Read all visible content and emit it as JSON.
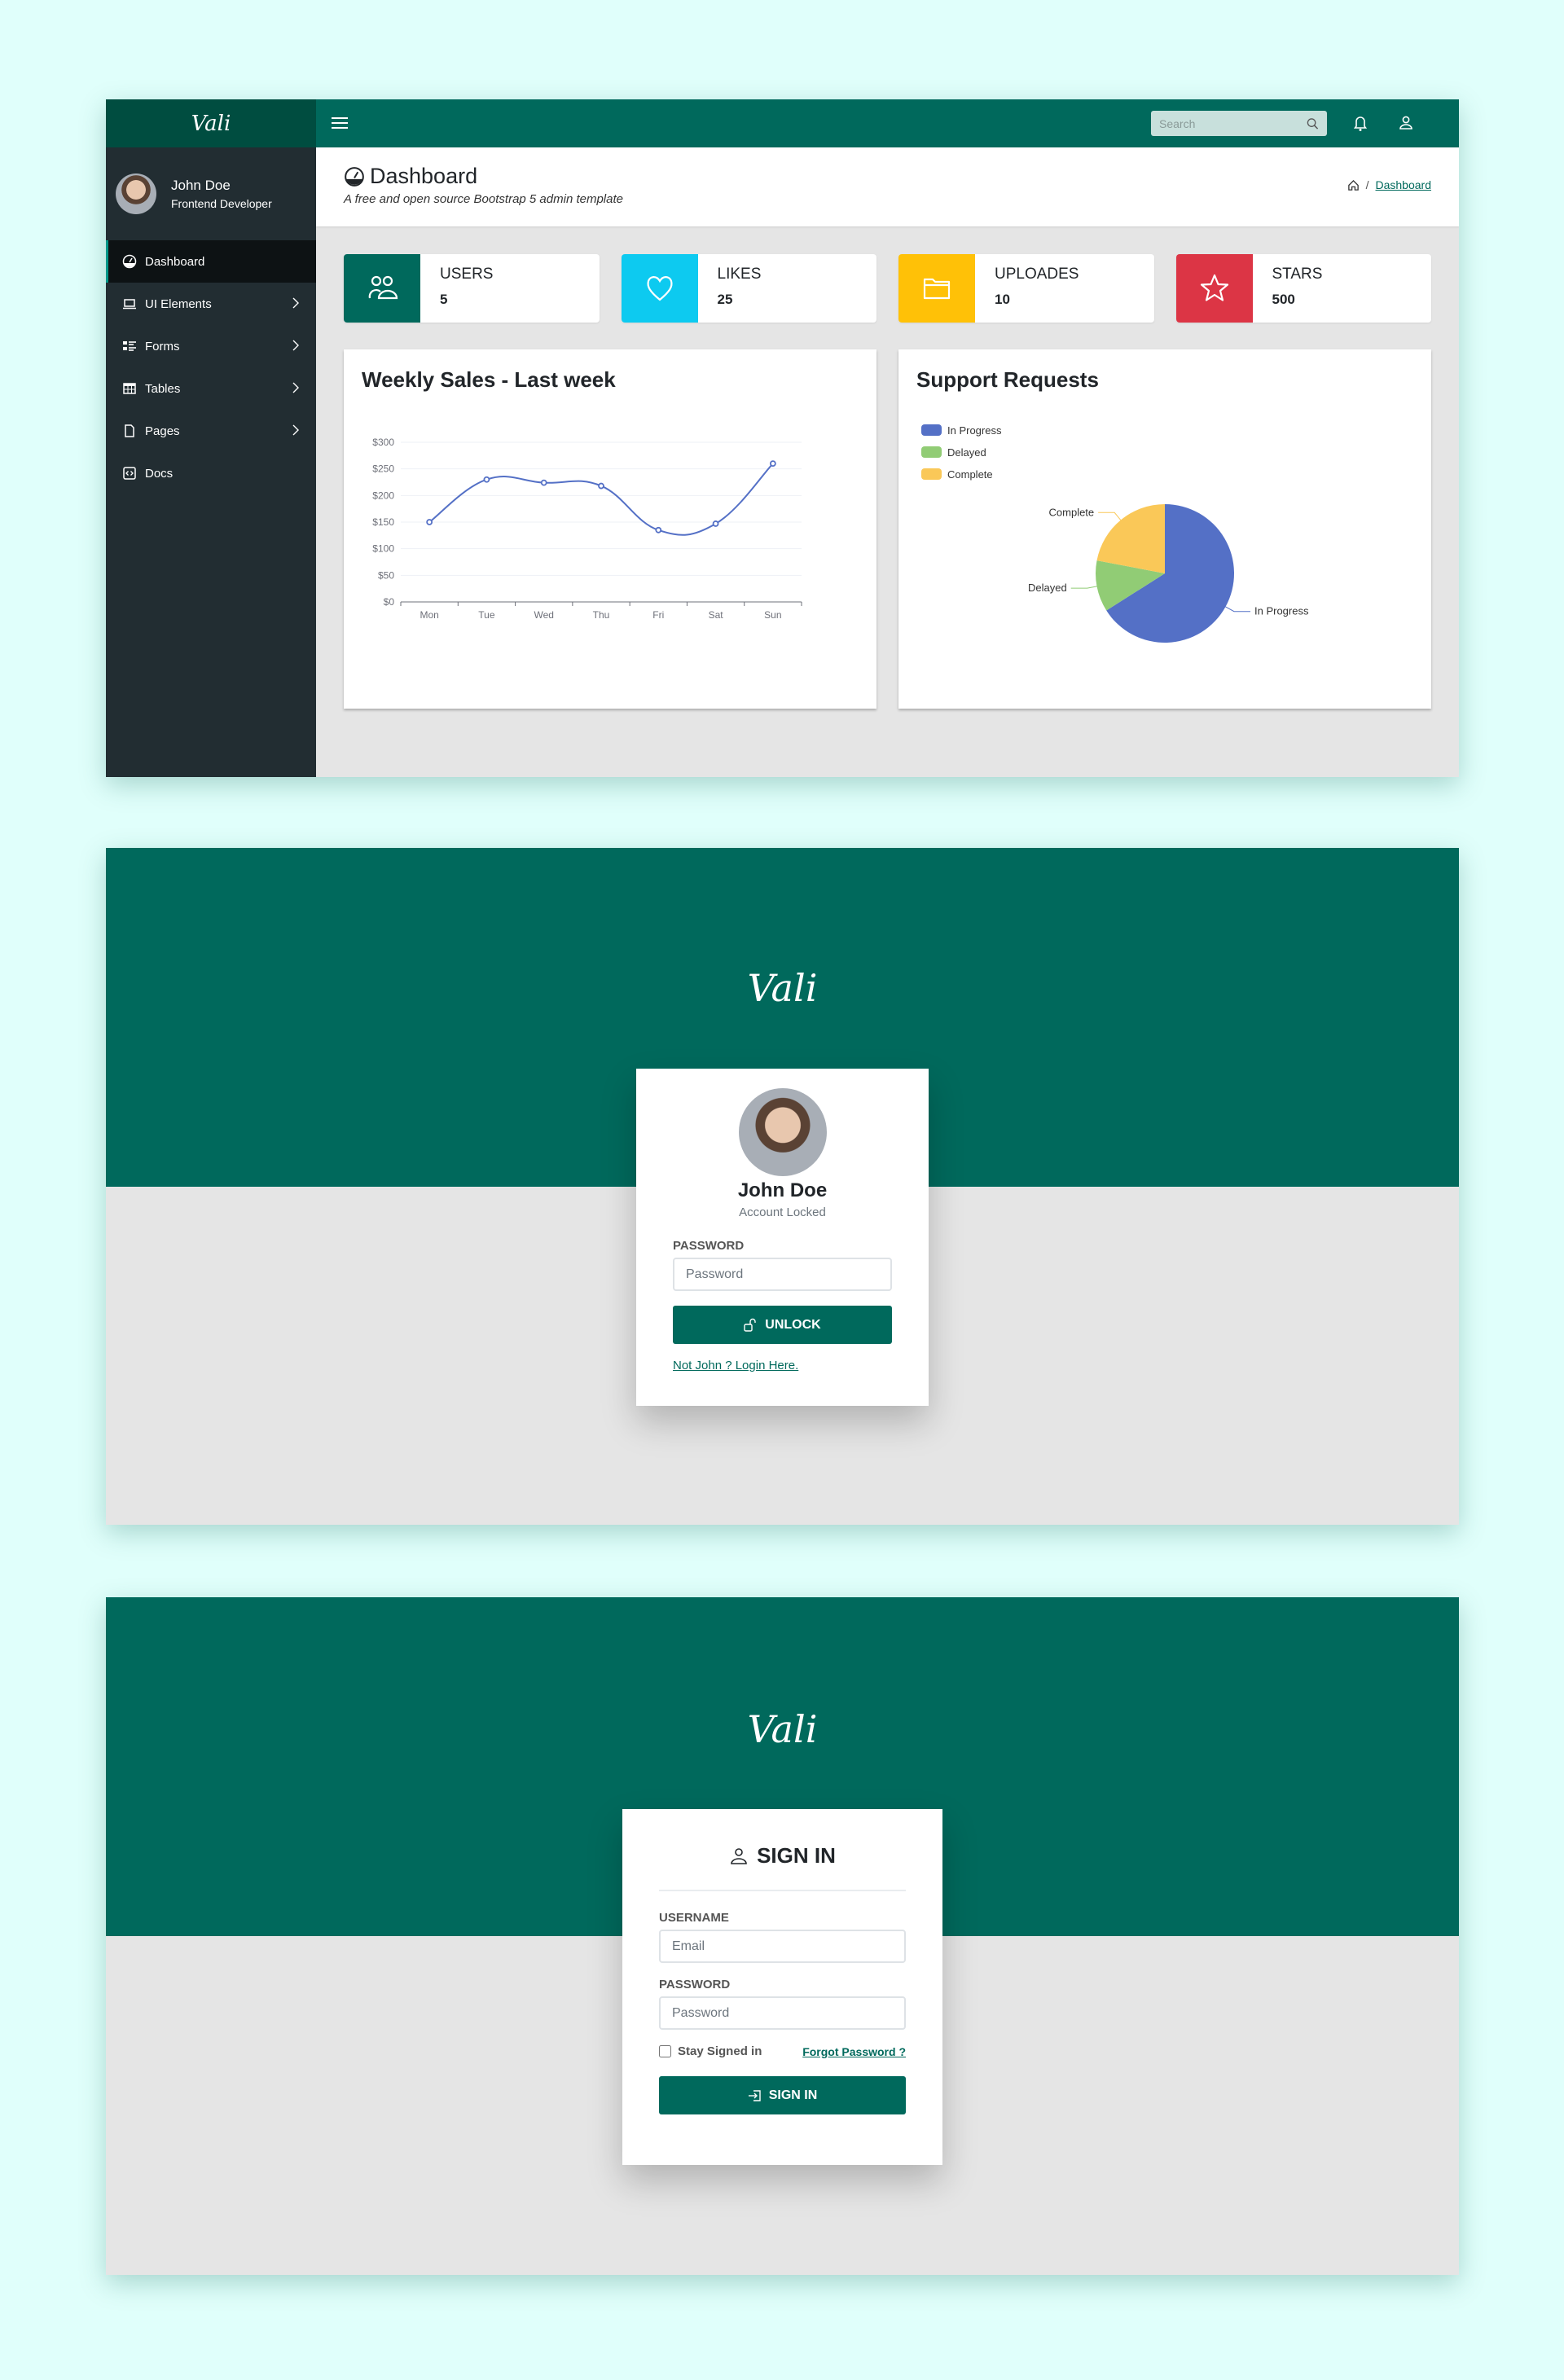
{
  "dashboard": {
    "brand": "Vali",
    "search": {
      "placeholder": "Search"
    },
    "user": {
      "name": "John Doe",
      "role": "Frontend Developer"
    },
    "sidebar": {
      "items": [
        {
          "label": "Dashboard",
          "icon": "speedometer-icon",
          "active": true,
          "has_children": false
        },
        {
          "label": "UI Elements",
          "icon": "laptop-icon",
          "active": false,
          "has_children": true
        },
        {
          "label": "Forms",
          "icon": "ui-checks-icon",
          "active": false,
          "has_children": true
        },
        {
          "label": "Tables",
          "icon": "table-icon",
          "active": false,
          "has_children": true
        },
        {
          "label": "Pages",
          "icon": "file-icon",
          "active": false,
          "has_children": true
        },
        {
          "label": "Docs",
          "icon": "code-square-icon",
          "active": false,
          "has_children": false
        }
      ]
    },
    "header": {
      "title": "Dashboard",
      "subtitle": "A free and open source Bootstrap 5 admin template",
      "breadcrumb": [
        "home-icon",
        "Dashboard"
      ]
    },
    "widgets": [
      {
        "label": "USERS",
        "value": "5",
        "icon": "people-icon",
        "color": "#00695c"
      },
      {
        "label": "LIKES",
        "value": "25",
        "icon": "heart-icon",
        "color": "#0dcaf0"
      },
      {
        "label": "UPLOADES",
        "value": "10",
        "icon": "folder-icon",
        "color": "#ffc107"
      },
      {
        "label": "STARS",
        "value": "500",
        "icon": "star-icon",
        "color": "#dc3545"
      }
    ],
    "colors": {
      "primary": "#00695c",
      "primary_dark": "#004d40",
      "sidebar": "#222d32"
    }
  },
  "chart_data": [
    {
      "type": "line",
      "title": "Weekly Sales - Last week",
      "categories": [
        "Mon",
        "Tue",
        "Wed",
        "Thu",
        "Fri",
        "Sat",
        "Sun"
      ],
      "values": [
        150,
        230,
        224,
        218,
        135,
        147,
        260
      ],
      "ylim": [
        0,
        300
      ],
      "yticks": [
        "$0",
        "$50",
        "$100",
        "$150",
        "$200",
        "$250",
        "$300"
      ],
      "ytick_values": [
        0,
        50,
        100,
        150,
        200,
        250,
        300
      ],
      "xlabel": "",
      "ylabel": "",
      "grid": true,
      "smooth": true,
      "color": "#5470c6"
    },
    {
      "type": "pie",
      "title": "Support Requests",
      "legend_position": "top-left",
      "slices": [
        {
          "name": "In Progress",
          "value": 66,
          "color": "#5470c6"
        },
        {
          "name": "Delayed",
          "value": 12,
          "color": "#91cc75"
        },
        {
          "name": "Complete",
          "value": 22,
          "color": "#fac858"
        }
      ]
    }
  ],
  "lockscreen": {
    "brand": "Vali",
    "user_name": "John Doe",
    "status": "Account Locked",
    "password_label": "PASSWORD",
    "password_placeholder": "Password",
    "unlock_label": "UNLOCK",
    "switch_user_link": "Not John ? Login Here."
  },
  "login": {
    "brand": "Vali",
    "title": "SIGN IN",
    "username_label": "USERNAME",
    "username_placeholder": "Email",
    "password_label": "PASSWORD",
    "password_placeholder": "Password",
    "remember_label": "Stay Signed in",
    "remember_checked": false,
    "forgot_link": "Forgot Password ?",
    "submit_label": "SIGN IN"
  }
}
